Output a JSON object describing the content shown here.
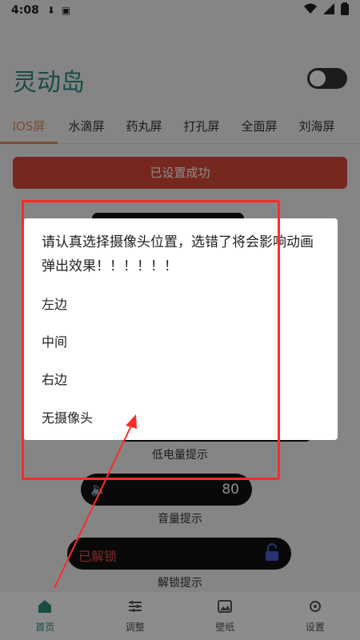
{
  "status_bar": {
    "time": "4:08"
  },
  "app": {
    "title": "灵动岛"
  },
  "tabs": [
    "IOS屏",
    "水滴屏",
    "药丸屏",
    "打孔屏",
    "全面屏",
    "刘海屏"
  ],
  "banner": {
    "text": "已设置成功"
  },
  "pills": {
    "battery_label": "低电量提示",
    "volume_value": "80",
    "volume_label": "音量提示",
    "unlock_text": "已解锁",
    "unlock_label": "解锁提示"
  },
  "dialog": {
    "message": "请认真选择摄像头位置，选错了将会影响动画弹出效果！！！！！！",
    "options": [
      "左边",
      "中间",
      "右边",
      "无摄像头"
    ]
  },
  "bottom_nav": {
    "items": [
      {
        "label": "首页",
        "icon": "home-icon"
      },
      {
        "label": "调整",
        "icon": "sliders-icon"
      },
      {
        "label": "壁纸",
        "icon": "image-icon"
      },
      {
        "label": "设置",
        "icon": "gear-icon"
      }
    ]
  },
  "colors": {
    "accent_teal": "#2f8a7a",
    "tab_active": "#e08a5a",
    "banner_red": "#d84a3a",
    "annotation_red": "#ff2a2a"
  }
}
